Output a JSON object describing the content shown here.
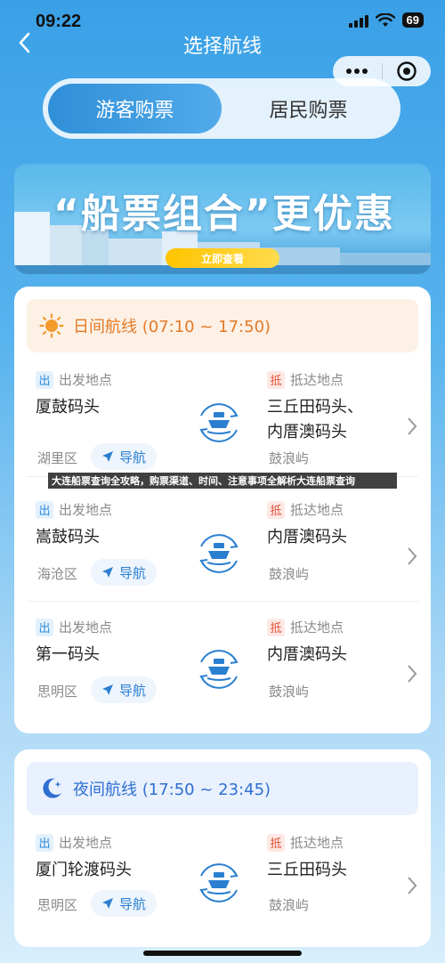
{
  "status_bar": {
    "time": "09:22",
    "battery": "69"
  },
  "header": {
    "title": "选择航线"
  },
  "tabs": [
    {
      "label": "游客购票",
      "active": true
    },
    {
      "label": "居民购票",
      "active": false
    }
  ],
  "banner": {
    "headline": "“船票组合”更优惠",
    "button_label": "立即查看"
  },
  "caption": "大连船票查询全攻略，购票渠道、时间、注意事项全解析大连船票查询",
  "day_section": {
    "title": "日间航线 (07:10 ~ 17:50)",
    "routes": [
      {
        "dep_tag": "出",
        "dep_label": "出发地点",
        "departure": "厦鼓码头",
        "dep_district": "湖里区",
        "nav_label": "导航",
        "arr_tag": "抵",
        "arr_label": "抵达地点",
        "arrival_line1": "三丘田码头、",
        "arrival_line2": "内厝澳码头",
        "arr_district": "鼓浪屿"
      },
      {
        "dep_tag": "出",
        "dep_label": "出发地点",
        "departure": "嵩鼓码头",
        "dep_district": "海沧区",
        "nav_label": "导航",
        "arr_tag": "抵",
        "arr_label": "抵达地点",
        "arrival_line1": "内厝澳码头",
        "arrival_line2": "",
        "arr_district": "鼓浪屿"
      },
      {
        "dep_tag": "出",
        "dep_label": "出发地点",
        "departure": "第一码头",
        "dep_district": "思明区",
        "nav_label": "导航",
        "arr_tag": "抵",
        "arr_label": "抵达地点",
        "arrival_line1": "内厝澳码头",
        "arrival_line2": "",
        "arr_district": "鼓浪屿"
      }
    ]
  },
  "night_section": {
    "title": "夜间航线 (17:50 ~ 23:45)",
    "routes": [
      {
        "dep_tag": "出",
        "dep_label": "出发地点",
        "departure": "厦门轮渡码头",
        "dep_district": "思明区",
        "nav_label": "导航",
        "arr_tag": "抵",
        "arr_label": "抵达地点",
        "arrival_line1": "三丘田码头",
        "arrival_line2": "",
        "arr_district": "鼓浪屿"
      }
    ]
  },
  "colors": {
    "accent": "#2f8fd7",
    "day": "#e37a27",
    "night": "#2f6fd1",
    "arrive_tag": "#e3523a"
  }
}
